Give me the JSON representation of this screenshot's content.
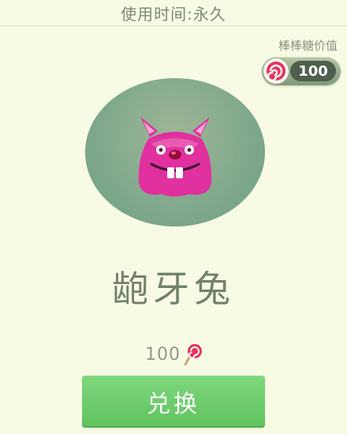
{
  "header": {
    "usage_time": "使用时间:永久"
  },
  "lollipop_value": {
    "label": "棒棒糖价值",
    "amount": "100"
  },
  "item": {
    "name": "龅牙兔",
    "price": "100"
  },
  "actions": {
    "exchange_label": "兑换"
  },
  "icons": {
    "candy": "lollipop-candy-icon",
    "avatar": "buck-tooth-bunny-icon"
  },
  "colors": {
    "button": "#6ccb6b",
    "background": "#f8fbe3",
    "bunny": "#e0319f"
  }
}
